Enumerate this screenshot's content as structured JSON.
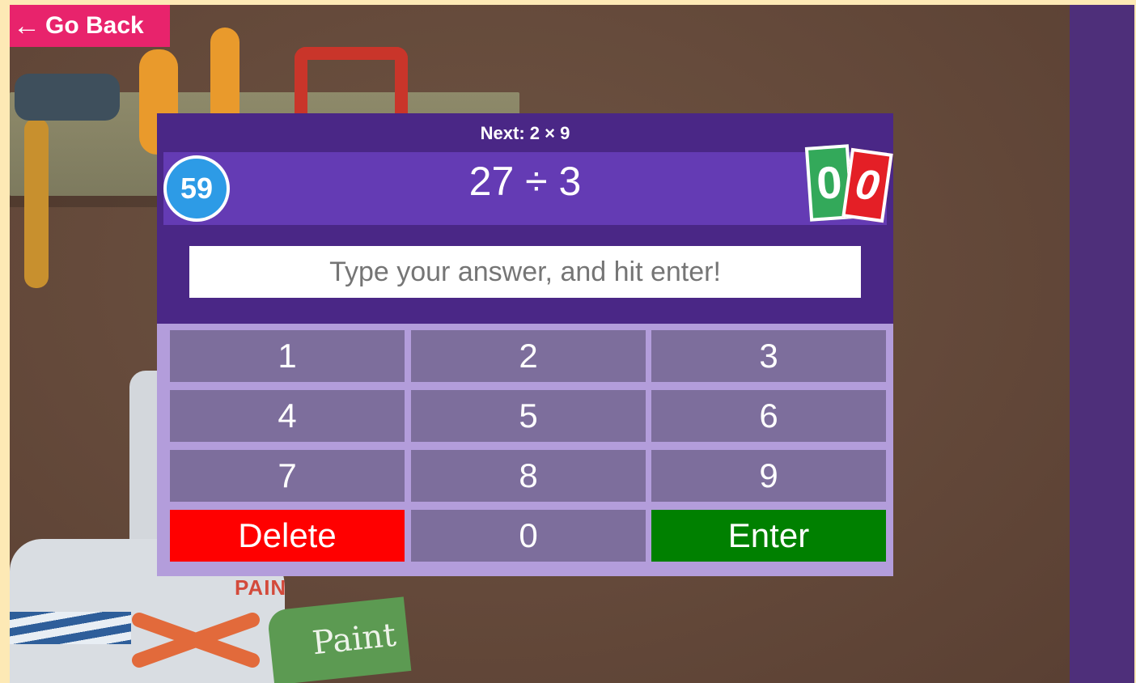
{
  "nav": {
    "back_label": "Go Back",
    "back_icon": "arrow-left-icon"
  },
  "quiz": {
    "next_label": "Next: 2 × 9",
    "timer": "59",
    "question": "27 ÷ 3",
    "score_correct": "0",
    "score_wrong": "0",
    "answer_value": "",
    "answer_placeholder": "Type your answer, and hit enter!"
  },
  "keypad": {
    "k1": "1",
    "k2": "2",
    "k3": "3",
    "k4": "4",
    "k5": "5",
    "k6": "6",
    "k7": "7",
    "k8": "8",
    "k9": "9",
    "delete": "Delete",
    "k0": "0",
    "enter": "Enter"
  },
  "scene": {
    "paint_label": "Paint",
    "can_text": "PAIN"
  },
  "colors": {
    "back_button": "#e8236c",
    "panel": "#4a2786",
    "question_bar": "#643bb4",
    "keypad_bg": "#b39ddb",
    "key": "#7d6e9c",
    "delete": "#ff0000",
    "enter": "#008000",
    "timer": "#2d9be6"
  }
}
